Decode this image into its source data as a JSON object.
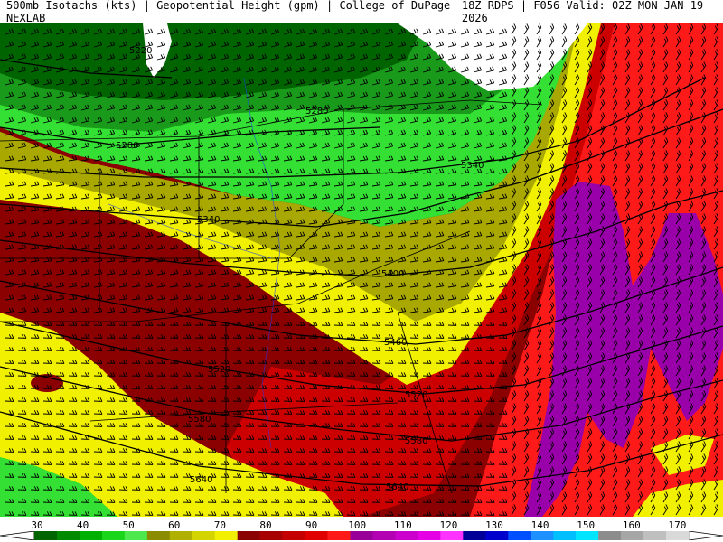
{
  "header": {
    "left_title": "500mb Isotachs (kts) | Geopotential Height (gpm) | College of DuPage NEXLAB",
    "right_title": "18Z RDPS | F056 Valid: 02Z MON JAN 19 2026"
  },
  "map": {
    "height_contours": [
      {
        "label": "5220",
        "color": "#000000"
      },
      {
        "label": "5280",
        "color": "#000000"
      },
      {
        "label": "5280",
        "color": "#000000"
      },
      {
        "label": "5340",
        "color": "#000000"
      },
      {
        "label": "5340",
        "color": "#000000"
      },
      {
        "label": "5400",
        "color": "#000000"
      },
      {
        "label": "5460",
        "color": "#000000"
      },
      {
        "label": "5520",
        "color": "#000000"
      },
      {
        "label": "5520",
        "color": "#000000"
      },
      {
        "label": "5580",
        "color": "#000000"
      },
      {
        "label": "5580",
        "color": "#000000"
      },
      {
        "label": "5640",
        "color": "#000000"
      },
      {
        "label": "5640",
        "color": "#000000"
      }
    ],
    "isotach_colors": {
      "30": "#006400",
      "40": "#1a9a1a",
      "50": "#33e033",
      "60": "#8c8c00",
      "70": "#f0f000",
      "80": "#8b0000",
      "90": "#cc0000",
      "100": "#ff1a1a",
      "110": "#9900aa",
      "120": "#d100d1",
      "130": "#ff33ff",
      "140": "#0000cc",
      "150": "#1e90ff",
      "160": "#00ccff",
      "170": "#a0a0a0"
    },
    "wind_barb_color": "#000000",
    "border_color": "#000000",
    "river_color": "#1a3cff"
  },
  "colorbar": {
    "ticks": [
      "30",
      "40",
      "50",
      "60",
      "70",
      "80",
      "90",
      "100",
      "110",
      "120",
      "130",
      "140",
      "150",
      "160",
      "170"
    ],
    "swatches": [
      "#006400",
      "#008a00",
      "#00b000",
      "#1ad61a",
      "#4de84d",
      "#8c8c00",
      "#b0b000",
      "#d4d400",
      "#f0f000",
      "#8b0000",
      "#a80000",
      "#c40000",
      "#e00000",
      "#ff1a1a",
      "#990099",
      "#b300b3",
      "#cc00cc",
      "#e600e6",
      "#ff33ff",
      "#000099",
      "#0000cc",
      "#0050ff",
      "#1e90ff",
      "#00bfff",
      "#00e5ff",
      "#8c8c8c",
      "#a6a6a6",
      "#bfbfbf",
      "#d9d9d9"
    ]
  }
}
